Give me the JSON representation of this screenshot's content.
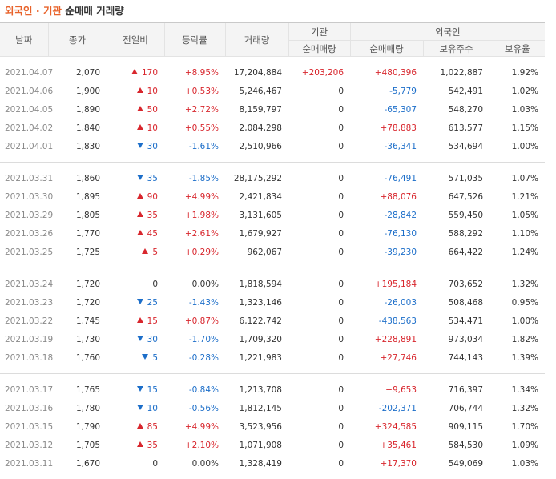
{
  "title": {
    "part1": "외국인",
    "sep": " · ",
    "part2": "기관",
    "part3": " 순매매 거래량"
  },
  "headers": {
    "date": "날짜",
    "close": "종가",
    "change": "전일비",
    "rate": "등락률",
    "volume": "거래량",
    "inst_group": "기관",
    "inst_net": "순매매량",
    "foreign_group": "외국인",
    "foreign_net": "순매매량",
    "foreign_hold": "보유주수",
    "foreign_ratio": "보유율"
  },
  "colors": {
    "up": "#d8262d",
    "down": "#1c6ec9",
    "title_accent": "#e8632b"
  },
  "groups": [
    [
      {
        "date": "2021.04.07",
        "close": "2,070",
        "dir": "up",
        "change": "170",
        "rate": "+8.95%",
        "volume": "17,204,884",
        "inst": "+203,206",
        "foreign": "+480,396",
        "hold": "1,022,887",
        "ratio": "1.92%"
      },
      {
        "date": "2021.04.06",
        "close": "1,900",
        "dir": "up",
        "change": "10",
        "rate": "+0.53%",
        "volume": "5,246,467",
        "inst": "0",
        "foreign": "-5,779",
        "hold": "542,491",
        "ratio": "1.02%"
      },
      {
        "date": "2021.04.05",
        "close": "1,890",
        "dir": "up",
        "change": "50",
        "rate": "+2.72%",
        "volume": "8,159,797",
        "inst": "0",
        "foreign": "-65,307",
        "hold": "548,270",
        "ratio": "1.03%"
      },
      {
        "date": "2021.04.02",
        "close": "1,840",
        "dir": "up",
        "change": "10",
        "rate": "+0.55%",
        "volume": "2,084,298",
        "inst": "0",
        "foreign": "+78,883",
        "hold": "613,577",
        "ratio": "1.15%"
      },
      {
        "date": "2021.04.01",
        "close": "1,830",
        "dir": "down",
        "change": "30",
        "rate": "-1.61%",
        "volume": "2,510,966",
        "inst": "0",
        "foreign": "-36,341",
        "hold": "534,694",
        "ratio": "1.00%"
      }
    ],
    [
      {
        "date": "2021.03.31",
        "close": "1,860",
        "dir": "down",
        "change": "35",
        "rate": "-1.85%",
        "volume": "28,175,292",
        "inst": "0",
        "foreign": "-76,491",
        "hold": "571,035",
        "ratio": "1.07%"
      },
      {
        "date": "2021.03.30",
        "close": "1,895",
        "dir": "up",
        "change": "90",
        "rate": "+4.99%",
        "volume": "2,421,834",
        "inst": "0",
        "foreign": "+88,076",
        "hold": "647,526",
        "ratio": "1.21%"
      },
      {
        "date": "2021.03.29",
        "close": "1,805",
        "dir": "up",
        "change": "35",
        "rate": "+1.98%",
        "volume": "3,131,605",
        "inst": "0",
        "foreign": "-28,842",
        "hold": "559,450",
        "ratio": "1.05%"
      },
      {
        "date": "2021.03.26",
        "close": "1,770",
        "dir": "up",
        "change": "45",
        "rate": "+2.61%",
        "volume": "1,679,927",
        "inst": "0",
        "foreign": "-76,130",
        "hold": "588,292",
        "ratio": "1.10%"
      },
      {
        "date": "2021.03.25",
        "close": "1,725",
        "dir": "up",
        "change": "5",
        "rate": "+0.29%",
        "volume": "962,067",
        "inst": "0",
        "foreign": "-39,230",
        "hold": "664,422",
        "ratio": "1.24%"
      }
    ],
    [
      {
        "date": "2021.03.24",
        "close": "1,720",
        "dir": "none",
        "change": "0",
        "rate": "0.00%",
        "volume": "1,818,594",
        "inst": "0",
        "foreign": "+195,184",
        "hold": "703,652",
        "ratio": "1.32%"
      },
      {
        "date": "2021.03.23",
        "close": "1,720",
        "dir": "down",
        "change": "25",
        "rate": "-1.43%",
        "volume": "1,323,146",
        "inst": "0",
        "foreign": "-26,003",
        "hold": "508,468",
        "ratio": "0.95%"
      },
      {
        "date": "2021.03.22",
        "close": "1,745",
        "dir": "up",
        "change": "15",
        "rate": "+0.87%",
        "volume": "6,122,742",
        "inst": "0",
        "foreign": "-438,563",
        "hold": "534,471",
        "ratio": "1.00%"
      },
      {
        "date": "2021.03.19",
        "close": "1,730",
        "dir": "down",
        "change": "30",
        "rate": "-1.70%",
        "volume": "1,709,320",
        "inst": "0",
        "foreign": "+228,891",
        "hold": "973,034",
        "ratio": "1.82%"
      },
      {
        "date": "2021.03.18",
        "close": "1,760",
        "dir": "down",
        "change": "5",
        "rate": "-0.28%",
        "volume": "1,221,983",
        "inst": "0",
        "foreign": "+27,746",
        "hold": "744,143",
        "ratio": "1.39%"
      }
    ],
    [
      {
        "date": "2021.03.17",
        "close": "1,765",
        "dir": "down",
        "change": "15",
        "rate": "-0.84%",
        "volume": "1,213,708",
        "inst": "0",
        "foreign": "+9,653",
        "hold": "716,397",
        "ratio": "1.34%"
      },
      {
        "date": "2021.03.16",
        "close": "1,780",
        "dir": "down",
        "change": "10",
        "rate": "-0.56%",
        "volume": "1,812,145",
        "inst": "0",
        "foreign": "-202,371",
        "hold": "706,744",
        "ratio": "1.32%"
      },
      {
        "date": "2021.03.15",
        "close": "1,790",
        "dir": "up",
        "change": "85",
        "rate": "+4.99%",
        "volume": "3,523,956",
        "inst": "0",
        "foreign": "+324,585",
        "hold": "909,115",
        "ratio": "1.70%"
      },
      {
        "date": "2021.03.12",
        "close": "1,705",
        "dir": "up",
        "change": "35",
        "rate": "+2.10%",
        "volume": "1,071,908",
        "inst": "0",
        "foreign": "+35,461",
        "hold": "584,530",
        "ratio": "1.09%"
      },
      {
        "date": "2021.03.11",
        "close": "1,670",
        "dir": "none",
        "change": "0",
        "rate": "0.00%",
        "volume": "1,328,419",
        "inst": "0",
        "foreign": "+17,370",
        "hold": "549,069",
        "ratio": "1.03%"
      }
    ]
  ]
}
